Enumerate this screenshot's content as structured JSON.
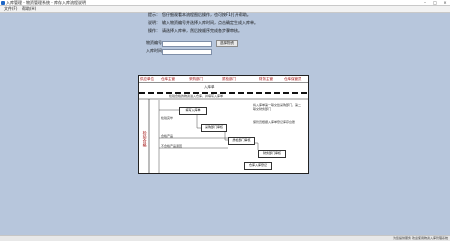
{
  "window": {
    "title": "入库管理 - 物资管理系统 - 库存入库流程说明",
    "minimize": "–",
    "maximize": "□",
    "close": "×"
  },
  "menu": [
    "文件(F)",
    "帮助(H)"
  ],
  "info": [
    {
      "label": "提示：",
      "text": "您仔细观看本流程图后操作，也可按F1打开帮助。"
    },
    {
      "label": "说明：",
      "text": "输入物资编号并选择入库时间，点击确定生成入库单。"
    },
    {
      "label": "操作：",
      "text": "请选择入库单，然后按顺序完成各步骤审核。"
    }
  ],
  "fields": [
    {
      "label": "物资编号",
      "value": "",
      "button": "选择物资"
    },
    {
      "label": "入库时间",
      "value": "",
      "button": ""
    }
  ],
  "diagram": {
    "lanes": [
      "供应单位",
      "仓库主管",
      "采购部门",
      "质检部门",
      "财务主管",
      "仓库保管员"
    ],
    "side_label": "检验合格",
    "banner": "入库单",
    "boxes": [
      "填写入库单",
      "采购部门审核",
      "质检部门审核",
      "财务部门审核",
      "仓库入库登记"
    ],
    "note_top": "检验合格的物资进入仓库，并填写入库单",
    "note_right_1": "将入库单第一联交给采购部门，第二联交财务部门",
    "note_right_2": "保管员根据入库单登记库存台账",
    "notes_left": [
      "检验完毕",
      "合格产品",
      "不合格产品退回"
    ]
  },
  "status": {
    "text": "为您提供服务    欢迎使用物资入库管理系统"
  }
}
